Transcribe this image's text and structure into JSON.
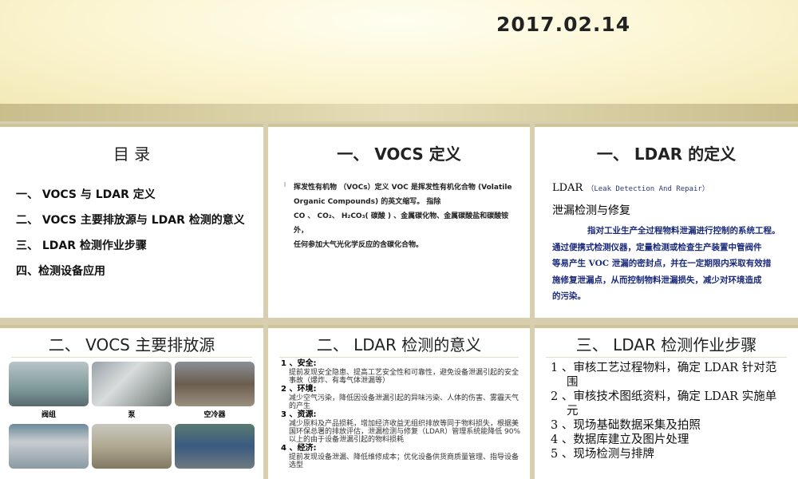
{
  "header": {
    "date": "2017.02.14"
  },
  "toc": {
    "title": "目 录",
    "items": [
      "一、 VOCS 与 LDAR 定义",
      "二、 VOCS 主要排放源与 LDAR 检测的意义",
      "三、 LDAR 检测作业步骤",
      "四、检测设备应用"
    ]
  },
  "voc_def": {
    "title": "一、 VOCS 定义",
    "lines": [
      "挥发性有机物 （VOCs）定义 VOC 是挥发性有机化合物 (Volatile",
      "Organic Compounds) 的英文缩写。 指除",
      "CO 、 CO₂、 H₂CO₃( 碳酸 ) 、金属碳化物、金属碳酸盐和碳酸铵外，",
      "任何参加大气光化学反应的含碳化合物。"
    ]
  },
  "ldar_def": {
    "title": "一、 LDAR 的定义",
    "abbr": "LDAR",
    "full": "（Leak Detection And Repair）",
    "cn": "泄漏检测与修复",
    "lines": [
      "指对工业生产全过程物料泄漏进行控制的系统工程。",
      "通过便携式检测仪器，定量检测或检查生产装置中管阀件",
      "等易产生 VOC 泄漏的密封点，并在一定期限内采取有效措",
      "施修复泄漏点，从而控制物料泄漏损失，减少对环境造成",
      "的污染。"
    ]
  },
  "sources": {
    "title": "二、 VOCS 主要排放源",
    "captions": [
      "阀组",
      "泵",
      "空冷器"
    ]
  },
  "significance": {
    "title": "二、 LDAR 检测的意义",
    "items": [
      {
        "head": "1 、安全:",
        "body": "提前发现安全隐患、提高工艺安全性和可靠性，避免设备泄漏引起的安全事故（爆炸、有毒气体泄漏等）"
      },
      {
        "head": "2 、环境:",
        "body": "减少空气污染，降低因设备泄漏引起的异味污染、人体的伤害、雾霾天气的产生"
      },
      {
        "head": "3 、资源:",
        "body": "减少原料及产品损耗，增加经济收益无组织排放等同于物料损失，根据美国环保总署的排放评估，泄漏检测与修复（LDAR）管理系统能降低 90% 以上的由于设备泄漏引起的物料损耗"
      },
      {
        "head": "4 、经济:",
        "body": "提前发现设备泄漏、降低维修成本；优化设备供货商质量管理、指导设备选型"
      }
    ]
  },
  "steps": {
    "title": "三、 LDAR 检测作业步骤",
    "items": [
      "1 、审核工艺过程物料，确定 LDAR 针对范围",
      "2 、审核技术图纸资料，确定 LDAR 实施单元",
      "3 、现场基础数据采集及拍照",
      "4 、数据库建立及图片处理",
      "5 、现场检测与排牌"
    ]
  }
}
